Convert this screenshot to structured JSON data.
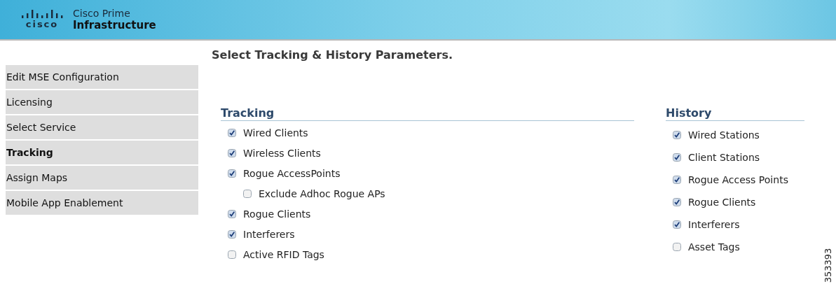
{
  "header": {
    "logo_wordmark": "cisco",
    "product_line1": "Cisco Prime",
    "product_line2": "Infrastructure"
  },
  "sidebar": {
    "items": [
      {
        "label": "Edit MSE Configuration",
        "selected": false
      },
      {
        "label": "Licensing",
        "selected": false
      },
      {
        "label": "Select Service",
        "selected": false
      },
      {
        "label": "Tracking",
        "selected": true
      },
      {
        "label": "Assign Maps",
        "selected": false
      },
      {
        "label": "Mobile App Enablement",
        "selected": false
      }
    ]
  },
  "page_title": "Select Tracking & History Parameters.",
  "sections": [
    {
      "title": "Tracking",
      "items": [
        {
          "label": "Wired Clients",
          "checked": true
        },
        {
          "label": "Wireless Clients",
          "checked": true
        },
        {
          "label": "Rogue AccessPoints",
          "checked": true,
          "children": [
            {
              "label": "Exclude Adhoc Rogue APs",
              "checked": false
            }
          ]
        },
        {
          "label": "Rogue Clients",
          "checked": true
        },
        {
          "label": "Interferers",
          "checked": true
        },
        {
          "label": "Active RFID Tags",
          "checked": false
        }
      ]
    },
    {
      "title": "History",
      "items": [
        {
          "label": "Wired Stations",
          "checked": true
        },
        {
          "label": "Client Stations",
          "checked": true
        },
        {
          "label": "Rogue Access Points",
          "checked": true
        },
        {
          "label": "Rogue Clients",
          "checked": true
        },
        {
          "label": "Interferers",
          "checked": true
        },
        {
          "label": "Asset Tags",
          "checked": false
        }
      ]
    }
  ],
  "figure_id": "353393"
}
